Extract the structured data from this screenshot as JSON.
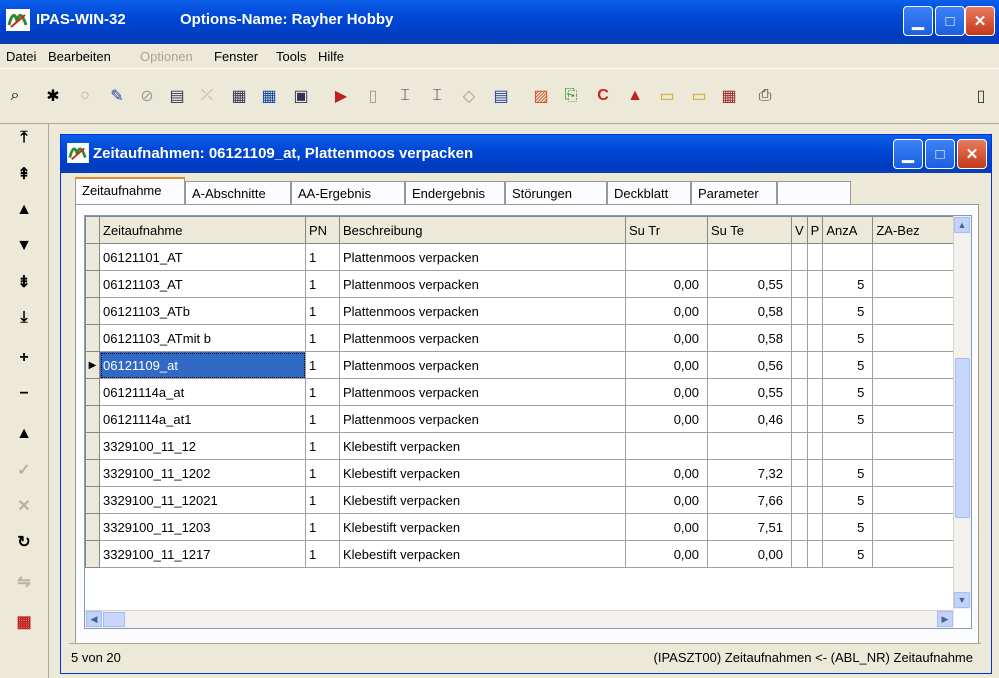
{
  "app": {
    "name": "IPAS-WIN-32",
    "options_name": "Options-Name: Rayher Hobby"
  },
  "menu": [
    "Datei",
    "Bearbeiten",
    "Optionen",
    "Fenster",
    "Tools",
    "Hilfe"
  ],
  "menu_disabled": [
    "Optionen"
  ],
  "toolbar_icons": [
    "search-icon",
    "filter-icon",
    "zoom-icon",
    "edit-pencil-icon",
    "link-icon",
    "form-icon",
    "report-icon",
    "calculator-icon",
    "grid-icon",
    "list-icon",
    "next-icon",
    "doc-icon",
    "tree-icon",
    "structure-icon",
    "eraser-icon",
    "notes-icon",
    "chart-icon",
    "copy-icon",
    "stop-icon",
    "graph-icon",
    "folder-up-icon",
    "folder-icon",
    "calendar-icon",
    "printer-icon",
    "exit-icon"
  ],
  "nav_icons": [
    "first-record-icon",
    "prev-page-icon",
    "prev-record-icon",
    "next-record-icon",
    "next-page-icon",
    "last-record-icon",
    "insert-record-icon",
    "delete-record-icon",
    "edit-record-icon",
    "confirm-icon",
    "cancel-icon",
    "refresh-icon",
    "share-icon",
    "exit-icon"
  ],
  "child_window": {
    "title": "Zeitaufnahmen: 06121109_at, Plattenmoos verpacken"
  },
  "tabs": [
    "Zeitaufnahme",
    "A-Abschnitte",
    "AA-Ergebnis",
    "Endergebnis",
    "Störungen",
    "Deckblatt",
    "Parameter"
  ],
  "active_tab": "Zeitaufnahme",
  "table": {
    "columns": [
      "Zeitaufnahme",
      "PN",
      "Beschreibung",
      "Su Tr",
      "Su Te",
      "V",
      "P",
      "AnzA",
      "ZA-Bez"
    ],
    "rows": [
      [
        "06121101_AT",
        "1",
        "Plattenmoos verpacken",
        "",
        "",
        "",
        "",
        "",
        ""
      ],
      [
        "06121103_AT",
        "1",
        "Plattenmoos verpacken",
        "0,00",
        "0,55",
        "",
        "",
        "5",
        ""
      ],
      [
        "06121103_ATb",
        "1",
        "Plattenmoos verpacken",
        "0,00",
        "0,58",
        "",
        "",
        "5",
        ""
      ],
      [
        "06121103_ATmit b",
        "1",
        "Plattenmoos verpacken",
        "0,00",
        "0,58",
        "",
        "",
        "5",
        ""
      ],
      [
        "06121109_at",
        "1",
        "Plattenmoos verpacken",
        "0,00",
        "0,56",
        "",
        "",
        "5",
        ""
      ],
      [
        "06121114a_at",
        "1",
        "Plattenmoos verpacken",
        "0,00",
        "0,55",
        "",
        "",
        "5",
        ""
      ],
      [
        "06121114a_at1",
        "1",
        "Plattenmoos verpacken",
        "0,00",
        "0,46",
        "",
        "",
        "5",
        ""
      ],
      [
        "3329100_11_12",
        "1",
        "Klebestift verpacken",
        "",
        "",
        "",
        "",
        "",
        ""
      ],
      [
        "3329100_11_1202",
        "1",
        "Klebestift verpacken",
        "0,00",
        "7,32",
        "",
        "",
        "5",
        ""
      ],
      [
        "3329100_11_12021",
        "1",
        "Klebestift verpacken",
        "0,00",
        "7,66",
        "",
        "",
        "5",
        ""
      ],
      [
        "3329100_11_1203",
        "1",
        "Klebestift verpacken",
        "0,00",
        "7,51",
        "",
        "",
        "5",
        ""
      ],
      [
        "3329100_11_1217",
        "1",
        "Klebestift verpacken",
        "0,00",
        "0,00",
        "",
        "",
        "5",
        ""
      ]
    ],
    "selected_row": 4
  },
  "status": {
    "left": "5 von 20",
    "right": "(IPASZT00) Zeitaufnahmen <- (ABL_NR) Zeitaufnahme"
  },
  "colors": {
    "title_blue": "#0047d6",
    "selection": "#316ac5",
    "close_red": "#c4391a"
  }
}
